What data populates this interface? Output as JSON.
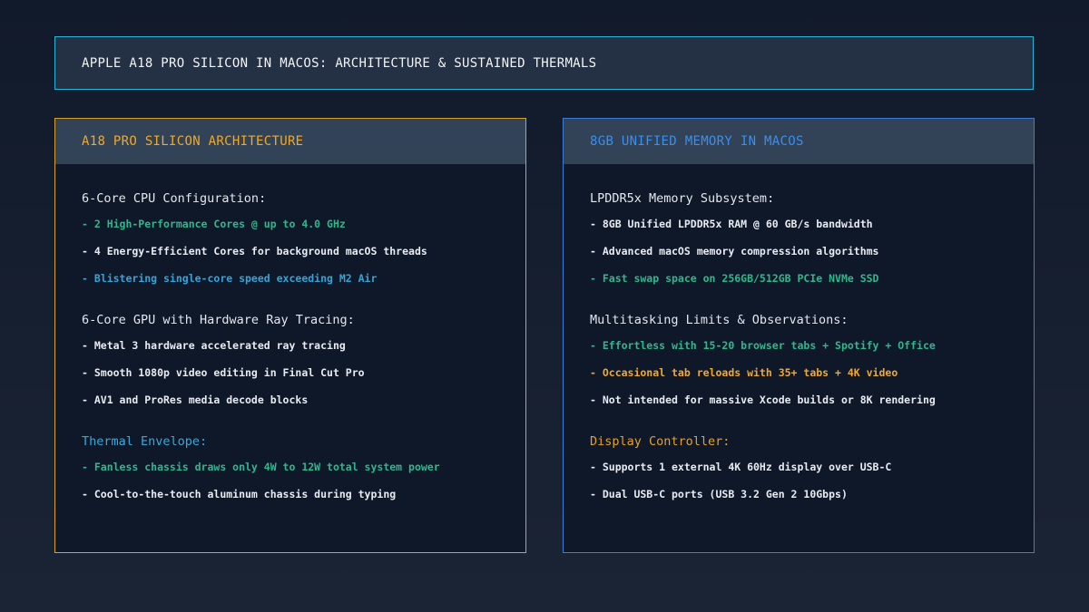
{
  "title": "APPLE A18 PRO SILICON IN MACOS: ARCHITECTURE & SUSTAINED THERMALS",
  "left_panel": {
    "header": "A18 PRO SILICON ARCHITECTURE",
    "sections": [
      {
        "title": "6-Core CPU Configuration:",
        "items": [
          "- 2 High-Performance Cores @ up to 4.0 GHz",
          "- 4 Energy-Efficient Cores for background macOS threads",
          "- Blistering single-core speed exceeding M2 Air"
        ]
      },
      {
        "title": "6-Core GPU with Hardware Ray Tracing:",
        "items": [
          "- Metal 3 hardware accelerated ray tracing",
          "- Smooth 1080p video editing in Final Cut Pro",
          "- AV1 and ProRes media decode blocks"
        ]
      },
      {
        "title": "Thermal Envelope:",
        "items": [
          "- Fanless chassis draws only 4W to 12W total system power",
          "- Cool-to-the-touch aluminum chassis during typing"
        ]
      }
    ]
  },
  "right_panel": {
    "header": "8GB UNIFIED MEMORY IN MACOS",
    "sections": [
      {
        "title": "LPDDR5x Memory Subsystem:",
        "items": [
          "- 8GB Unified LPDDR5x RAM @ 60 GB/s bandwidth",
          "- Advanced macOS memory compression algorithms",
          "- Fast swap space on 256GB/512GB PCIe NVMe SSD"
        ]
      },
      {
        "title": "Multitasking Limits & Observations:",
        "items": [
          "- Effortless with 15-20 browser tabs + Spotify + Office",
          "- Occasional tab reloads with 35+ tabs + 4K video",
          "- Not intended for massive Xcode builds or 8K rendering"
        ]
      },
      {
        "title": "Display Controller:",
        "items": [
          "- Supports 1 external 4K 60Hz display over USB-C",
          "- Dual USB-C ports (USB 3.2 Gen 2 10Gbps)"
        ]
      }
    ]
  },
  "colors": {
    "accent_orange": "#f0a92b",
    "accent_blue": "#3a8ff0",
    "accent_cyan": "#2ab3d6",
    "highlight_green": "#2fb88c"
  }
}
